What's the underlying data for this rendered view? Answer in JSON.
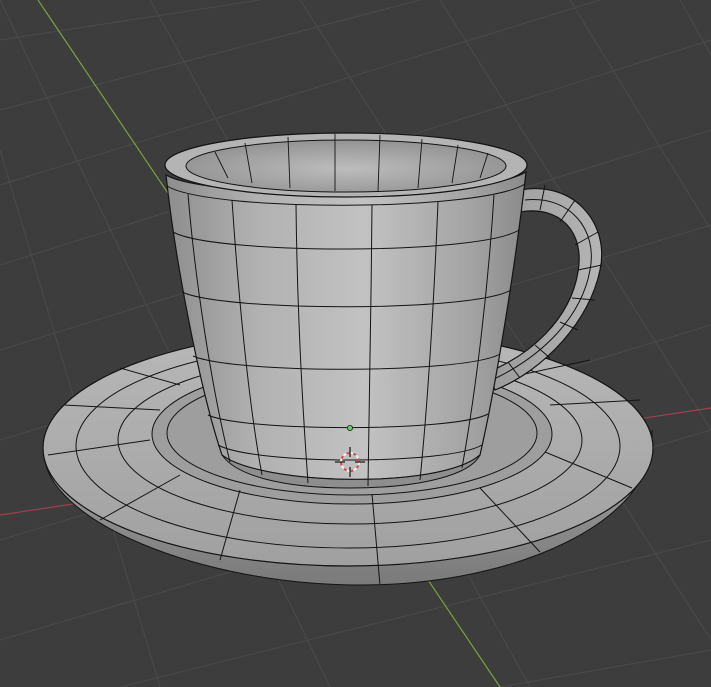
{
  "viewport": {
    "mode": "3d-viewport-solid-with-wireframe-overlay",
    "background_color": "#3d3d3d",
    "grid_line_color": "#4a4a4a",
    "x_axis_color": "#a2404e",
    "y_axis_color": "#7aa13c",
    "mesh_base_color": "#a9a9a9",
    "wire_color": "#141414"
  },
  "objects": [
    {
      "name": "cup",
      "selected": false
    },
    {
      "name": "saucer",
      "selected": false
    }
  ],
  "gizmos": {
    "origin_icon": "object-origin-dot",
    "cursor_icon": "3d-cursor-icon",
    "origin_color": "#5bd35b",
    "cursor_ring_colors": [
      "#d64a4a",
      "#f2f2f2"
    ]
  }
}
